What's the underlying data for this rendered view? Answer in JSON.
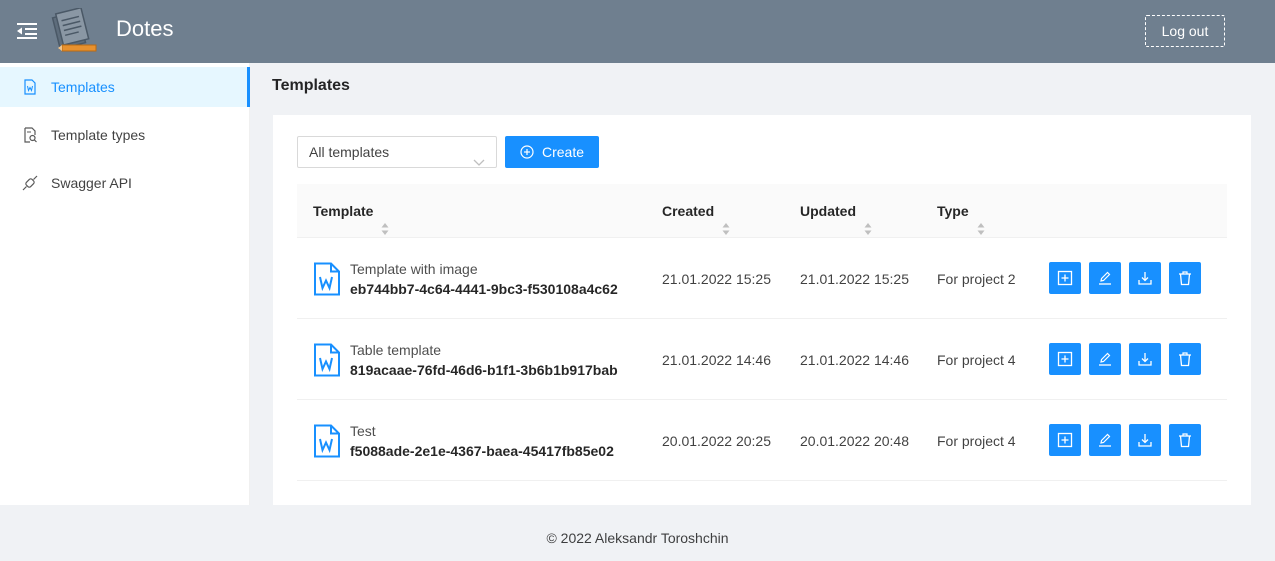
{
  "header": {
    "app_title": "Dotes",
    "logout_label": "Log out",
    "background": "#6f7f8f"
  },
  "sidebar": {
    "items": [
      {
        "label": "Templates",
        "icon": "word-file-icon",
        "active": true
      },
      {
        "label": "Template types",
        "icon": "file-search-icon",
        "active": false
      },
      {
        "label": "Swagger API",
        "icon": "api-icon",
        "active": false
      }
    ]
  },
  "main": {
    "page_title": "Templates",
    "filter": {
      "selected": "All templates"
    },
    "create_label": "Create",
    "table": {
      "columns": [
        "Template",
        "Created",
        "Updated",
        "Type"
      ],
      "rows": [
        {
          "name": "Template with image",
          "id": "eb744bb7-4c64-4441-9bc3-f530108a4c62",
          "created": "21.01.2022 15:25",
          "updated": "21.01.2022 15:25",
          "type": "For project 2"
        },
        {
          "name": "Table template",
          "id": "819acaae-76fd-46d6-b1f1-3b6b1b917bab",
          "created": "21.01.2022 14:46",
          "updated": "21.01.2022 14:46",
          "type": "For project 4"
        },
        {
          "name": "Test",
          "id": "f5088ade-2e1e-4367-baea-45417fb85e02",
          "created": "20.01.2022 20:25",
          "updated": "20.01.2022 20:48",
          "type": "For project 4"
        }
      ],
      "row_actions": [
        "plus-square-icon",
        "edit-icon",
        "download-icon",
        "delete-icon"
      ]
    }
  },
  "footer": {
    "text": "© 2022 Aleksandr Toroshchin"
  },
  "colors": {
    "accent": "#1890ff",
    "page_bg": "#f0f2f5",
    "active_bg": "#e6f7ff"
  }
}
